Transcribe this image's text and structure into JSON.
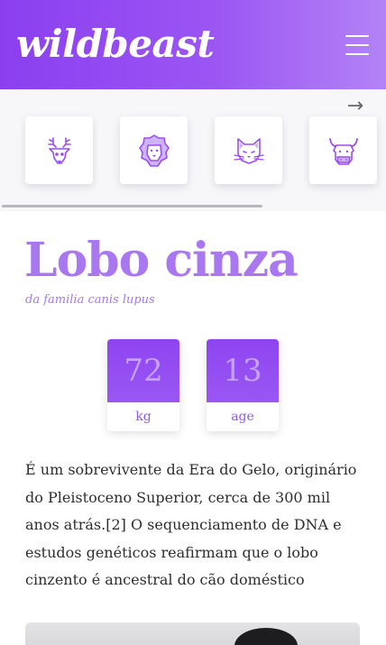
{
  "header": {
    "logo": "wildbeast",
    "menu_icon": "hamburger-menu-icon",
    "gradient": [
      "#8b3ff0",
      "#b383f6"
    ]
  },
  "carousel": {
    "next_icon": "arrow-right-icon",
    "next_glyph": "→",
    "items": [
      {
        "icon": "deer-icon"
      },
      {
        "icon": "lion-icon"
      },
      {
        "icon": "cat-icon"
      },
      {
        "icon": "bull-icon"
      }
    ]
  },
  "animal": {
    "name": "Lobo cinza",
    "family": "da familia canis lupus",
    "stats": [
      {
        "value": "72",
        "unit": "kg"
      },
      {
        "value": "13",
        "unit": "age"
      }
    ],
    "description": "É um sobrevivente da Era do Gelo, originário do Pleistoceno Superior, cerca de 300 mil anos atrás.[2] O sequenciamento de DNA e estudos genéticos reafirmam que o lobo cinzento é ancestral do cão doméstico"
  },
  "colors": {
    "accent": "#9b55f3",
    "title": "#a978f0",
    "text": "#2e2e2e"
  }
}
